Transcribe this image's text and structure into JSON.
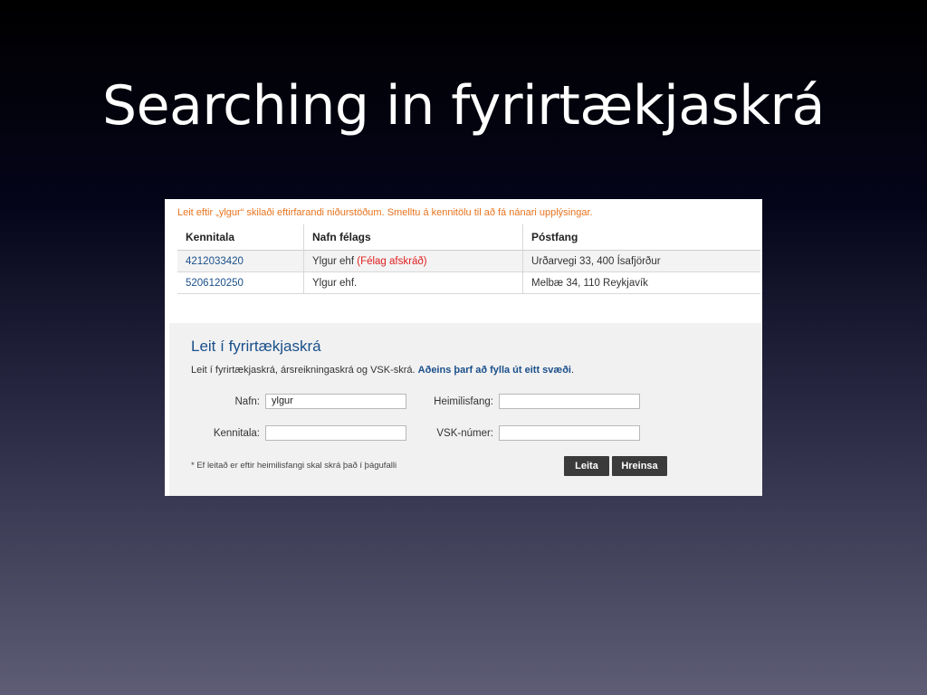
{
  "slide": {
    "title": "Searching in fyrirtækjaskrá"
  },
  "results": {
    "message": "Leit eftir „ylgur“ skilaði eftirfarandi niðurstöðum. Smelltu á kennitölu til að fá nánari upplýsingar.",
    "columns": [
      "Kennitala",
      "Nafn félags",
      "Póstfang"
    ],
    "rows": [
      {
        "kennitala": "4212033420",
        "name": "Ylgur ehf",
        "status": "(Félag afskráð)",
        "address": "Urðarvegi 33, 400 Ísafjörður"
      },
      {
        "kennitala": "5206120250",
        "name": "Ylgur ehf.",
        "status": "",
        "address": "Melbæ 34, 110 Reykjavík"
      }
    ]
  },
  "search": {
    "title": "Leit í fyrirtækjaskrá",
    "description": "Leit í fyrirtækjaskrá, ársreikningaskrá og VSK-skrá.",
    "hint": "Aðeins þarf að fylla út eitt svæði",
    "hint_end": ".",
    "fields": {
      "nafn": {
        "label": "Nafn:",
        "value": "ylgur"
      },
      "kennitala": {
        "label": "Kennitala:",
        "value": ""
      },
      "heimilisfang": {
        "label": "Heimilisfang:",
        "value": ""
      },
      "vsk": {
        "label": "VSK-númer:",
        "value": ""
      }
    },
    "footnote": "* Ef leitað er eftir heimilisfangi skal skrá það í þágufalli",
    "search_button": "Leita",
    "clear_button": "Hreinsa"
  }
}
